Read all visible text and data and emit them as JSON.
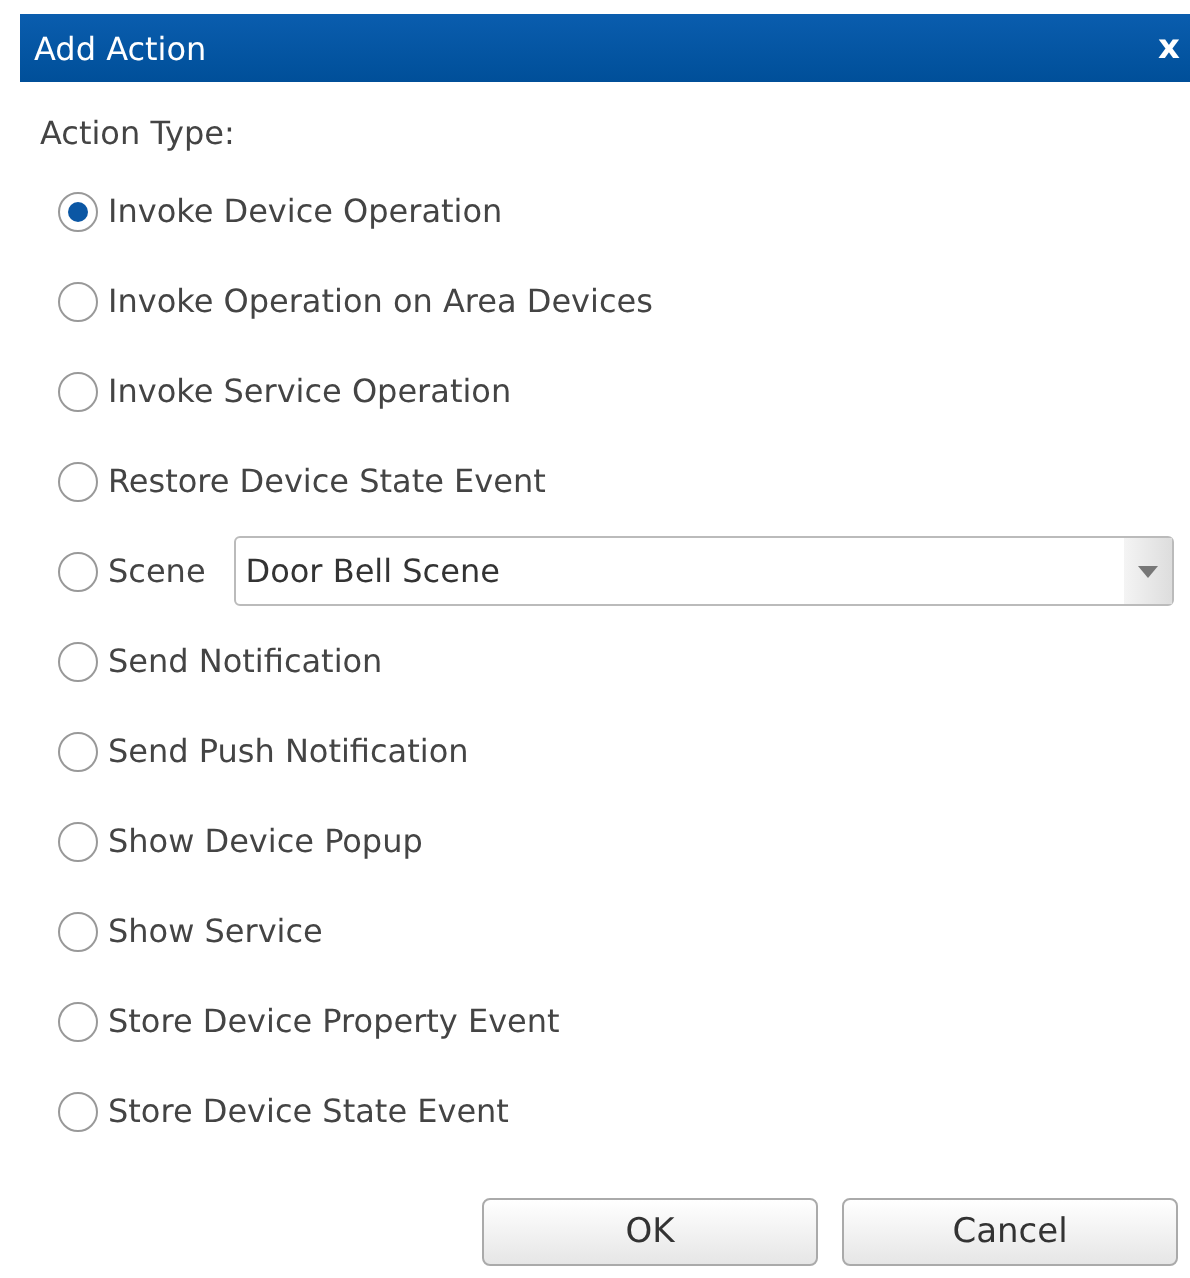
{
  "window": {
    "title": "Add Action",
    "close": "x"
  },
  "section_label": "Action Type:",
  "options": [
    {
      "label": "Invoke Device Operation",
      "selected": true,
      "kind": "radio"
    },
    {
      "label": "Invoke Operation on Area Devices",
      "selected": false,
      "kind": "radio"
    },
    {
      "label": "Invoke Service Operation",
      "selected": false,
      "kind": "radio"
    },
    {
      "label": "Restore Device State Event",
      "selected": false,
      "kind": "radio"
    },
    {
      "label": "Scene",
      "selected": false,
      "kind": "select",
      "value": "Door Bell Scene"
    },
    {
      "label": "Send Notification",
      "selected": false,
      "kind": "radio"
    },
    {
      "label": "Send Push Notification",
      "selected": false,
      "kind": "radio"
    },
    {
      "label": "Show Device Popup",
      "selected": false,
      "kind": "radio"
    },
    {
      "label": "Show Service",
      "selected": false,
      "kind": "radio"
    },
    {
      "label": "Store Device Property Event",
      "selected": false,
      "kind": "radio"
    },
    {
      "label": "Store Device State Event",
      "selected": false,
      "kind": "radio"
    }
  ],
  "buttons": [
    "OK",
    "Cancel"
  ]
}
